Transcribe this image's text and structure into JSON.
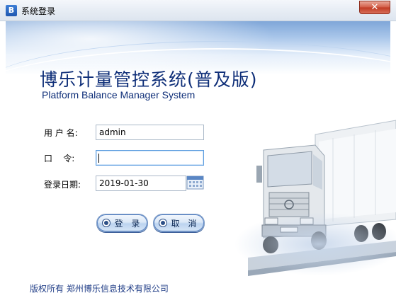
{
  "window": {
    "title": "系统登录",
    "app_icon": "app-logo-icon",
    "close_symbol": "✕"
  },
  "banner": {
    "title": "博乐计量管控系统(普及版)",
    "subtitle": "Platform Balance Manager System"
  },
  "form": {
    "username_label": "用 户 名:",
    "username_value": "admin",
    "password_label": "口    令:",
    "password_value": "",
    "date_label": "登录日期:",
    "date_value": "2019-01-30",
    "calendar_icon": "calendar-icon"
  },
  "buttons": {
    "login": "登 录",
    "cancel": "取 消"
  },
  "footer": {
    "copyright": "版权所有  郑州博乐信息技术有限公司"
  },
  "colors": {
    "title_blue": "#0e2e78",
    "close_red": "#c03a23",
    "button_border": "#7f9cc4"
  }
}
